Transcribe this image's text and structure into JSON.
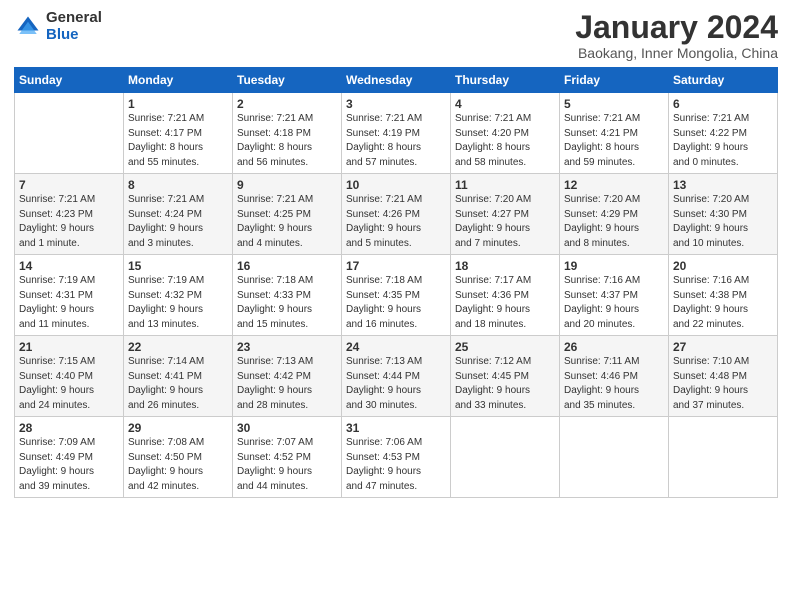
{
  "logo": {
    "general": "General",
    "blue": "Blue"
  },
  "title": "January 2024",
  "subtitle": "Baokang, Inner Mongolia, China",
  "days_of_week": [
    "Sunday",
    "Monday",
    "Tuesday",
    "Wednesday",
    "Thursday",
    "Friday",
    "Saturday"
  ],
  "weeks": [
    [
      {
        "day": "",
        "info": ""
      },
      {
        "day": "1",
        "info": "Sunrise: 7:21 AM\nSunset: 4:17 PM\nDaylight: 8 hours\nand 55 minutes."
      },
      {
        "day": "2",
        "info": "Sunrise: 7:21 AM\nSunset: 4:18 PM\nDaylight: 8 hours\nand 56 minutes."
      },
      {
        "day": "3",
        "info": "Sunrise: 7:21 AM\nSunset: 4:19 PM\nDaylight: 8 hours\nand 57 minutes."
      },
      {
        "day": "4",
        "info": "Sunrise: 7:21 AM\nSunset: 4:20 PM\nDaylight: 8 hours\nand 58 minutes."
      },
      {
        "day": "5",
        "info": "Sunrise: 7:21 AM\nSunset: 4:21 PM\nDaylight: 8 hours\nand 59 minutes."
      },
      {
        "day": "6",
        "info": "Sunrise: 7:21 AM\nSunset: 4:22 PM\nDaylight: 9 hours\nand 0 minutes."
      }
    ],
    [
      {
        "day": "7",
        "info": "Sunrise: 7:21 AM\nSunset: 4:23 PM\nDaylight: 9 hours\nand 1 minute."
      },
      {
        "day": "8",
        "info": "Sunrise: 7:21 AM\nSunset: 4:24 PM\nDaylight: 9 hours\nand 3 minutes."
      },
      {
        "day": "9",
        "info": "Sunrise: 7:21 AM\nSunset: 4:25 PM\nDaylight: 9 hours\nand 4 minutes."
      },
      {
        "day": "10",
        "info": "Sunrise: 7:21 AM\nSunset: 4:26 PM\nDaylight: 9 hours\nand 5 minutes."
      },
      {
        "day": "11",
        "info": "Sunrise: 7:20 AM\nSunset: 4:27 PM\nDaylight: 9 hours\nand 7 minutes."
      },
      {
        "day": "12",
        "info": "Sunrise: 7:20 AM\nSunset: 4:29 PM\nDaylight: 9 hours\nand 8 minutes."
      },
      {
        "day": "13",
        "info": "Sunrise: 7:20 AM\nSunset: 4:30 PM\nDaylight: 9 hours\nand 10 minutes."
      }
    ],
    [
      {
        "day": "14",
        "info": "Sunrise: 7:19 AM\nSunset: 4:31 PM\nDaylight: 9 hours\nand 11 minutes."
      },
      {
        "day": "15",
        "info": "Sunrise: 7:19 AM\nSunset: 4:32 PM\nDaylight: 9 hours\nand 13 minutes."
      },
      {
        "day": "16",
        "info": "Sunrise: 7:18 AM\nSunset: 4:33 PM\nDaylight: 9 hours\nand 15 minutes."
      },
      {
        "day": "17",
        "info": "Sunrise: 7:18 AM\nSunset: 4:35 PM\nDaylight: 9 hours\nand 16 minutes."
      },
      {
        "day": "18",
        "info": "Sunrise: 7:17 AM\nSunset: 4:36 PM\nDaylight: 9 hours\nand 18 minutes."
      },
      {
        "day": "19",
        "info": "Sunrise: 7:16 AM\nSunset: 4:37 PM\nDaylight: 9 hours\nand 20 minutes."
      },
      {
        "day": "20",
        "info": "Sunrise: 7:16 AM\nSunset: 4:38 PM\nDaylight: 9 hours\nand 22 minutes."
      }
    ],
    [
      {
        "day": "21",
        "info": "Sunrise: 7:15 AM\nSunset: 4:40 PM\nDaylight: 9 hours\nand 24 minutes."
      },
      {
        "day": "22",
        "info": "Sunrise: 7:14 AM\nSunset: 4:41 PM\nDaylight: 9 hours\nand 26 minutes."
      },
      {
        "day": "23",
        "info": "Sunrise: 7:13 AM\nSunset: 4:42 PM\nDaylight: 9 hours\nand 28 minutes."
      },
      {
        "day": "24",
        "info": "Sunrise: 7:13 AM\nSunset: 4:44 PM\nDaylight: 9 hours\nand 30 minutes."
      },
      {
        "day": "25",
        "info": "Sunrise: 7:12 AM\nSunset: 4:45 PM\nDaylight: 9 hours\nand 33 minutes."
      },
      {
        "day": "26",
        "info": "Sunrise: 7:11 AM\nSunset: 4:46 PM\nDaylight: 9 hours\nand 35 minutes."
      },
      {
        "day": "27",
        "info": "Sunrise: 7:10 AM\nSunset: 4:48 PM\nDaylight: 9 hours\nand 37 minutes."
      }
    ],
    [
      {
        "day": "28",
        "info": "Sunrise: 7:09 AM\nSunset: 4:49 PM\nDaylight: 9 hours\nand 39 minutes."
      },
      {
        "day": "29",
        "info": "Sunrise: 7:08 AM\nSunset: 4:50 PM\nDaylight: 9 hours\nand 42 minutes."
      },
      {
        "day": "30",
        "info": "Sunrise: 7:07 AM\nSunset: 4:52 PM\nDaylight: 9 hours\nand 44 minutes."
      },
      {
        "day": "31",
        "info": "Sunrise: 7:06 AM\nSunset: 4:53 PM\nDaylight: 9 hours\nand 47 minutes."
      },
      {
        "day": "",
        "info": ""
      },
      {
        "day": "",
        "info": ""
      },
      {
        "day": "",
        "info": ""
      }
    ]
  ]
}
